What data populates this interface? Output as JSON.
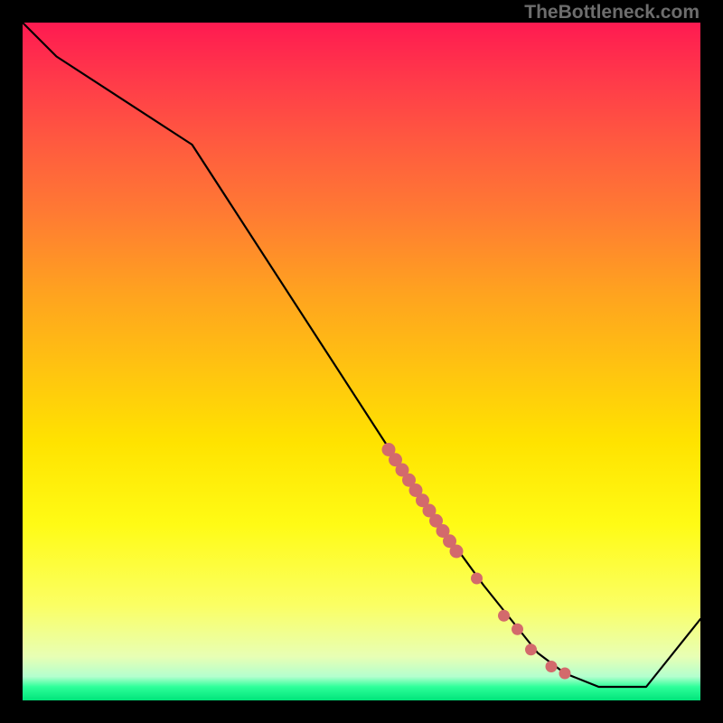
{
  "watermark": "TheBottleneck.com",
  "chart_data": {
    "type": "line",
    "title": "",
    "xlabel": "",
    "ylabel": "",
    "xlim": [
      0,
      100
    ],
    "ylim": [
      0,
      100
    ],
    "grid": false,
    "legend": false,
    "series": [
      {
        "name": "curve",
        "x": [
          0,
          5,
          25,
          60,
          68,
          72,
          76,
          80,
          85,
          92,
          100
        ],
        "values": [
          100,
          95,
          82,
          28,
          17,
          12,
          7,
          4,
          2,
          2,
          12
        ]
      }
    ],
    "markers": {
      "name": "highlight-segment",
      "color": "#d36a6c",
      "points": [
        {
          "x": 54,
          "y": 37.0
        },
        {
          "x": 55,
          "y": 35.5
        },
        {
          "x": 56,
          "y": 34.0
        },
        {
          "x": 57,
          "y": 32.5
        },
        {
          "x": 58,
          "y": 31.0
        },
        {
          "x": 59,
          "y": 29.5
        },
        {
          "x": 60,
          "y": 28.0
        },
        {
          "x": 61,
          "y": 26.5
        },
        {
          "x": 62,
          "y": 25.0
        },
        {
          "x": 63,
          "y": 23.5
        },
        {
          "x": 64,
          "y": 22.0
        },
        {
          "x": 67,
          "y": 18.0
        },
        {
          "x": 71,
          "y": 12.5
        },
        {
          "x": 73,
          "y": 10.5
        },
        {
          "x": 75,
          "y": 7.5
        },
        {
          "x": 78,
          "y": 5.0
        },
        {
          "x": 80,
          "y": 4.0
        }
      ]
    },
    "colors": {
      "line": "#000000",
      "marker": "#d36a6c",
      "background_top": "#ff1a51",
      "background_bottom": "#00e47a",
      "frame": "#000000"
    }
  }
}
